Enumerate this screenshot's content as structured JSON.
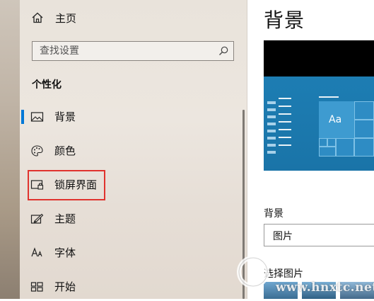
{
  "nav": {
    "home_label": "主页",
    "search_placeholder": "查找设置",
    "section_title": "个性化",
    "items": [
      {
        "label": "背景",
        "icon": "picture-icon",
        "selected": true
      },
      {
        "label": "颜色",
        "icon": "palette-icon",
        "selected": false
      },
      {
        "label": "锁屏界面",
        "icon": "lock-screen-icon",
        "selected": false
      },
      {
        "label": "主题",
        "icon": "theme-brush-icon",
        "selected": false
      },
      {
        "label": "字体",
        "icon": "font-icon",
        "selected": false
      },
      {
        "label": "开始",
        "icon": "start-tiles-icon",
        "selected": false
      }
    ]
  },
  "main": {
    "title": "背景",
    "preview": {
      "tile_text": "Aa"
    },
    "background_label": "背景",
    "background_value": "图片",
    "choose_label": "选择图片"
  },
  "watermark": {
    "text": "www.hnxtc.net"
  },
  "colors": {
    "accent": "#0078d7",
    "highlight_border": "#e0332e",
    "preview_blue": "#1d7db3"
  }
}
